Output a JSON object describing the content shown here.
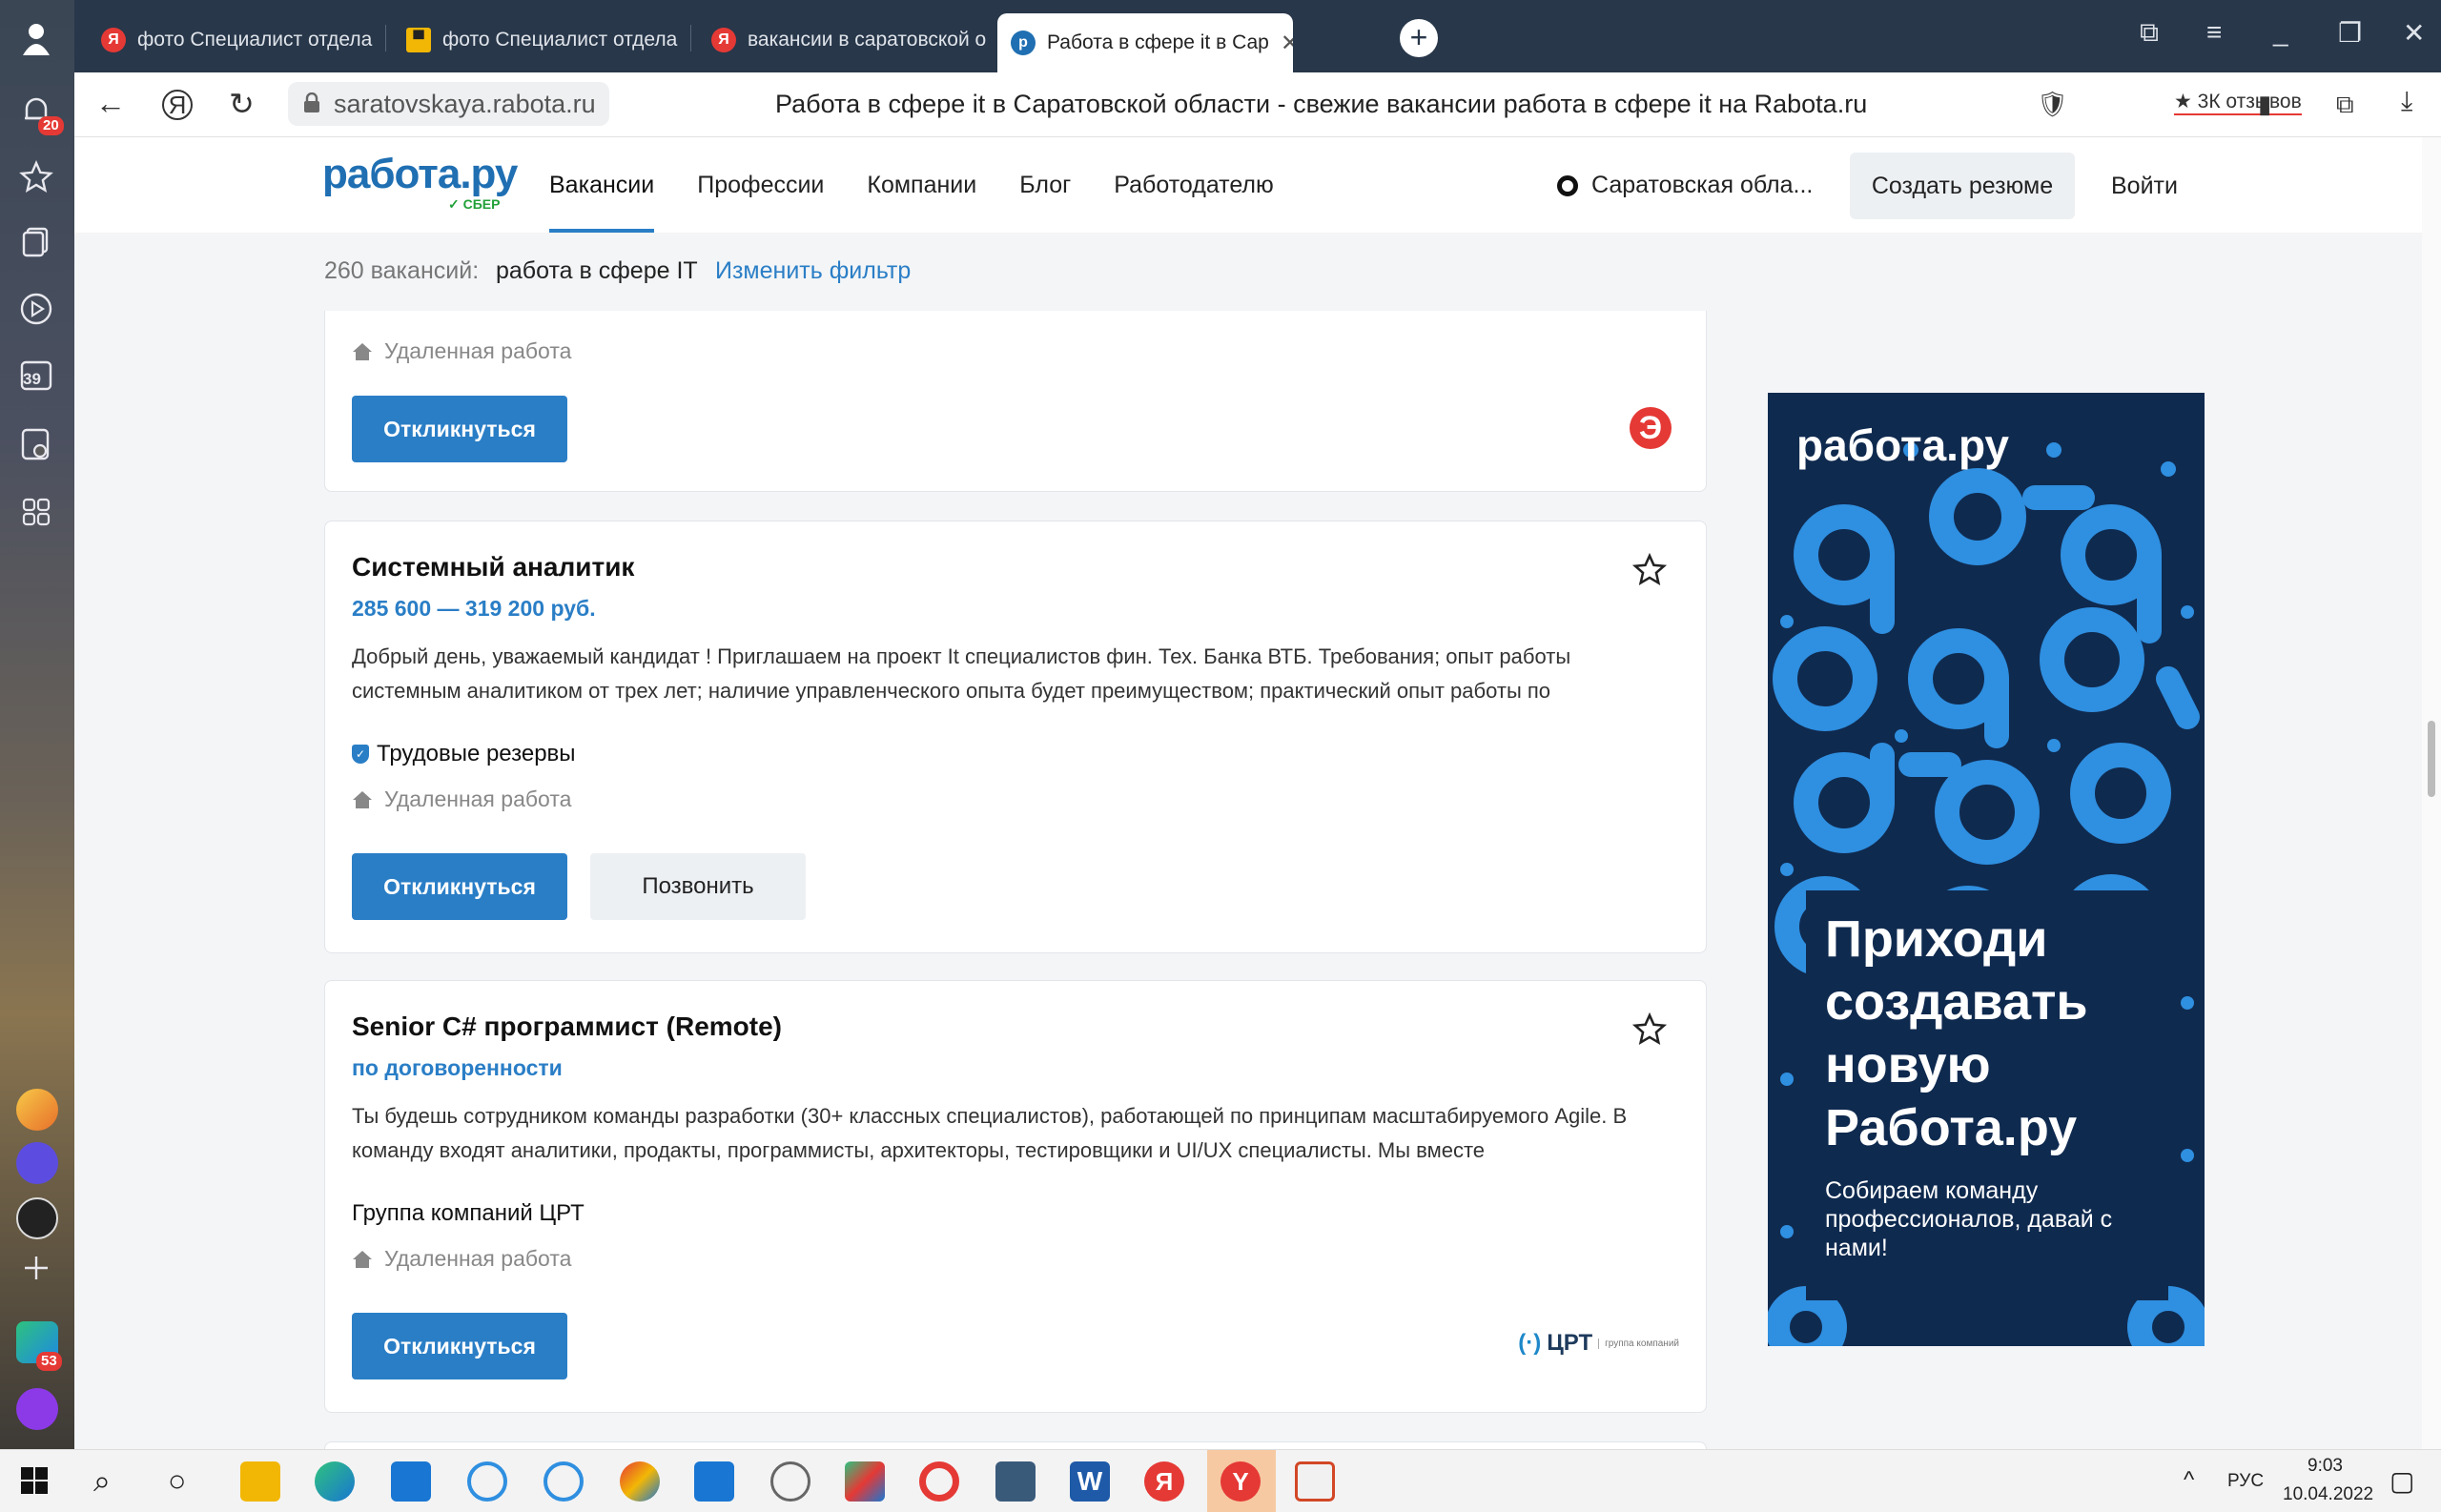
{
  "browser": {
    "tabs": [
      {
        "label": "фото Специалист отдела"
      },
      {
        "label": "фото Специалист отдела"
      },
      {
        "label": "вакансии в саратовской о"
      },
      {
        "label": "Работа в сфере it в Сар"
      }
    ],
    "url": "saratovskaya.rabota.ru",
    "page_title": "Работа в сфере it в Саратовской области - свежие вакансии работа в сфере it на Rabota.ru",
    "reviews": "★ 3К отзывов",
    "sidebar_badges": {
      "notifications": "20",
      "app": "53",
      "calendar": "39"
    }
  },
  "site": {
    "logo": "работа.ру",
    "logo_sub": "СБЕР",
    "nav": [
      "Вакансии",
      "Профессии",
      "Компании",
      "Блог",
      "Работодателю"
    ],
    "region": "Саратовская обла...",
    "create_resume": "Создать резюме",
    "login": "Войти"
  },
  "filter": {
    "count": "260 вакансий:",
    "query": "работа в сфере IT",
    "change": "Изменить фильтр"
  },
  "vacancies": [
    {
      "remote": "Удаленная работа",
      "apply": "Откликнуться",
      "logo": "Э"
    },
    {
      "title": "Системный аналитик",
      "salary": "285 600 — 319 200 руб.",
      "description": "Добрый день, уважаемый кандидат ! Приглашаем на проект It специалистов фин. Тех. Банка ВТБ. Требования; опыт работы системным аналитиком от трех лет; наличие управленческого опыта будет преимуществом; практический опыт работы по",
      "company": "Трудовые резервы",
      "remote": "Удаленная работа",
      "apply": "Откликнуться",
      "call": "Позвонить"
    },
    {
      "title": "Senior C# программист (Remote)",
      "salary": "по договоренности",
      "description": "Ты будешь сотрудником команды разработки (30+ классных специалистов), работающей по принципам масштабируемого Agile. В команду входят аналитики, продакты, программисты, архитекторы, тестировщики и UI/UX специалисты. Мы вместе",
      "company": "Группа компаний ЦРТ",
      "remote": "Удаленная работа",
      "apply": "Откликнуться",
      "logo": "ЦРТ",
      "logo_sub": "группа компаний"
    }
  ],
  "ad": {
    "logo": "работа.ру",
    "headline": "Приходи создавать новую Работа.ру",
    "sub": "Собираем команду профессионалов, давай с нами!"
  },
  "taskbar": {
    "lang": "РУС",
    "time": "9:03",
    "date": "10.04.2022"
  },
  "colors": {
    "brand_blue": "#2a7ec6",
    "tabbar": "#28374a",
    "ad_bg": "#0f2a4f",
    "ad_pattern": "#2f8fe0"
  }
}
